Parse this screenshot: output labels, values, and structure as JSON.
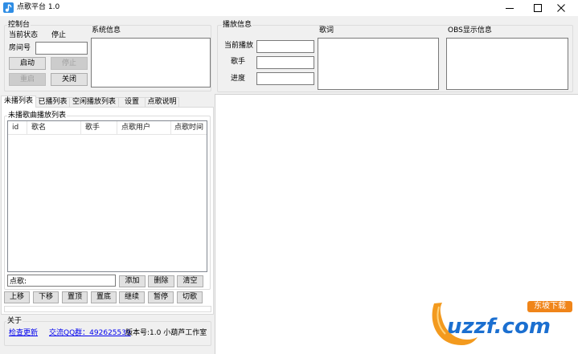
{
  "window": {
    "title": "点歌平台 1.0",
    "app_icon": "music-note-icon",
    "controls": [
      "minimize-icon",
      "maximize-icon",
      "close-icon"
    ]
  },
  "control_panel": {
    "title": "控制台",
    "status_label": "当前状态",
    "status_value": "停止",
    "room_label": "房间号",
    "room_value": "",
    "start_button": {
      "label": "启动",
      "enabled": true
    },
    "stop_button": {
      "label": "停止",
      "enabled": false
    },
    "restart_button": {
      "label": "重启",
      "enabled": false
    },
    "close_button": {
      "label": "关闭",
      "enabled": true
    },
    "system_info_label": "系统信息",
    "system_info_value": ""
  },
  "play_info": {
    "title": "播放信息",
    "now_playing_label": "当前播放",
    "now_playing_value": "",
    "singer_label": "歌手",
    "singer_value": "",
    "progress_label": "进度",
    "progress_value": "",
    "lyrics_label": "歌词",
    "lyrics_value": "",
    "obs_label": "OBS显示信息",
    "obs_value": ""
  },
  "tabs": [
    "未播列表",
    "已播列表",
    "空闲播放列表",
    "设置",
    "点歌说明"
  ],
  "active_tab_index": 0,
  "queue": {
    "title": "未播歌曲播放列表",
    "columns": [
      "id",
      "歌名",
      "歌手",
      "点歌用户",
      "点歌时间"
    ],
    "rows": [],
    "request_input_value": "点歌:",
    "add_button": "添加",
    "delete_button": "删除",
    "clear_button": "清空",
    "order_buttons": [
      "上移",
      "下移",
      "置顶",
      "置底",
      "继续",
      "暂停",
      "切歌"
    ]
  },
  "about": {
    "title": "关于",
    "check_update_link": "检查更新",
    "qq_group_link": "交流QQ群：492625539",
    "version_text": "版本号:1.0 小葫芦工作室"
  },
  "watermark": {
    "brand": "uzzf.com",
    "badge": "东坡下载"
  },
  "colors": {
    "window_bg": "#f0f0f0",
    "app_icon": "#2f8de4",
    "link": "#0000ee",
    "disabled_text": "#a0a0a0",
    "watermark_blue": "#1b6fd0",
    "watermark_orange": "#f08519"
  }
}
